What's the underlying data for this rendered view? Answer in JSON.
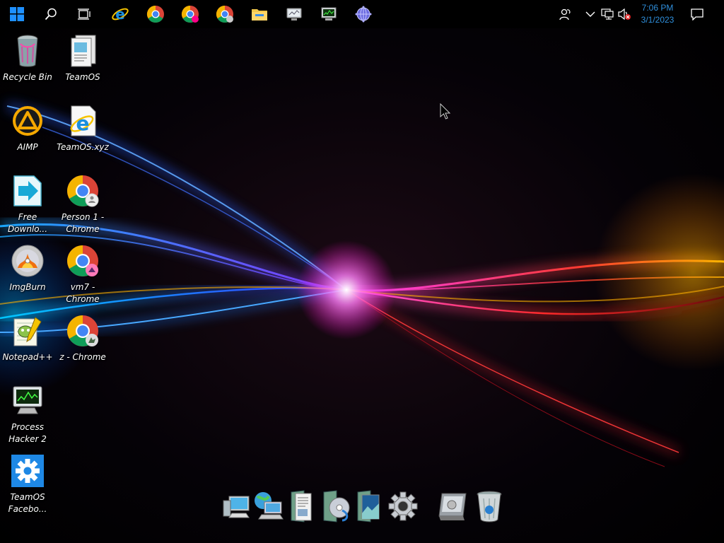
{
  "taskbar": {
    "pinned": [
      {
        "name": "start-button",
        "icon": "windows-logo-icon"
      },
      {
        "name": "search-button",
        "icon": "search-icon"
      },
      {
        "name": "task-view-button",
        "icon": "task-view-icon"
      },
      {
        "name": "internet-explorer-button",
        "icon": "internet-explorer-icon"
      },
      {
        "name": "chrome-button-1",
        "icon": "chrome-icon"
      },
      {
        "name": "chrome-button-2",
        "icon": "chrome-icon"
      },
      {
        "name": "chrome-button-3",
        "icon": "chrome-icon"
      },
      {
        "name": "file-explorer-button",
        "icon": "folder-icon"
      },
      {
        "name": "monitor-app-button",
        "icon": "monitor-icon"
      },
      {
        "name": "process-hacker-button",
        "icon": "process-hacker-icon"
      },
      {
        "name": "network-app-button",
        "icon": "globe-icon"
      }
    ],
    "tray": {
      "icons": [
        "people-icon",
        "chevron-up-icon",
        "network-icon",
        "volume-muted-icon"
      ],
      "clock": {
        "time": "7:06 PM",
        "date": "3/1/2023"
      },
      "notification_icon": "action-center-icon"
    },
    "colors": {
      "background": "#000000",
      "clock_text": "#2f8fdc"
    }
  },
  "desktop": {
    "icons": [
      {
        "label": "Recycle Bin",
        "icon": "recycle-bin-icon"
      },
      {
        "label": "TeamOS",
        "icon": "document-icon"
      },
      {
        "label": "AIMP",
        "icon": "aimp-icon"
      },
      {
        "label": "TeamOS.xyz",
        "icon": "internet-explorer-icon"
      },
      {
        "label": "Free\nDownlo...",
        "icon": "free-download-icon"
      },
      {
        "label": "Person 1 -\nChrome",
        "icon": "chrome-icon"
      },
      {
        "label": "ImgBurn",
        "icon": "imgburn-icon"
      },
      {
        "label": "vm7 -\nChrome",
        "icon": "chrome-icon"
      },
      {
        "label": "Notepad++",
        "icon": "notepad-plus-icon"
      },
      {
        "label": "z - Chrome",
        "icon": "chrome-icon"
      },
      {
        "label": "Process\nHacker 2",
        "icon": "process-hacker-icon"
      },
      {
        "label": "TeamOS\nFacebo...",
        "icon": "gear-icon"
      }
    ]
  },
  "dock": {
    "items": [
      "computer-icon",
      "network-computer-icon",
      "documents-icon",
      "media-icon",
      "pictures-icon",
      "settings-gear-icon",
      "system-panel-icon",
      "recycle-bin-icon"
    ]
  }
}
